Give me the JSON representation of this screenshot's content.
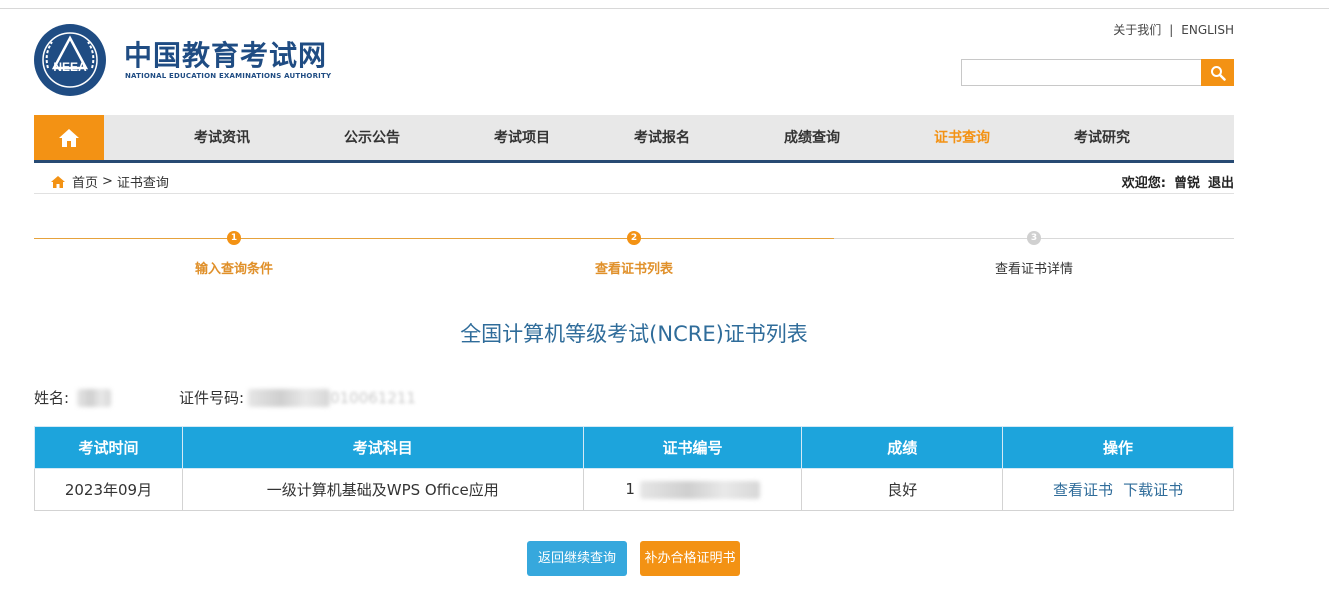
{
  "header": {
    "brand_cn": "中国教育考试网",
    "brand_en": "NATIONAL EDUCATION EXAMINATIONS AUTHORITY",
    "logo_text": "NEEA",
    "about": "关于我们",
    "separator": "|",
    "english": "ENGLISH",
    "search_placeholder": ""
  },
  "nav": {
    "home_icon": "home-icon",
    "items": [
      {
        "label": "考试资讯"
      },
      {
        "label": "公示公告"
      },
      {
        "label": "考试项目"
      },
      {
        "label": "考试报名"
      },
      {
        "label": "成绩查询"
      },
      {
        "label": "证书查询",
        "active": true
      },
      {
        "label": "考试研究"
      }
    ]
  },
  "breadcrumb": {
    "home": "首页",
    "separator": ">",
    "current": "证书查询"
  },
  "user": {
    "welcome": "欢迎您:",
    "name": "曾锐",
    "logout": "退出"
  },
  "steps": [
    {
      "num": "1",
      "label": "输入查询条件",
      "done": true
    },
    {
      "num": "2",
      "label": "查看证书列表",
      "done": true
    },
    {
      "num": "3",
      "label": "查看证书详情",
      "done": false
    }
  ],
  "page_title": "全国计算机等级考试(NCRE)证书列表",
  "person": {
    "name_label": "姓名:",
    "id_label": "证件号码:",
    "id_visible_tail": "010061211"
  },
  "table": {
    "headers": [
      "考试时间",
      "考试科目",
      "证书编号",
      "成绩",
      "操作"
    ],
    "rows": [
      {
        "time": "2023年09月",
        "subject": "一级计算机基础及WPS Office应用",
        "cert_no_prefix": "1",
        "score": "良好",
        "action_view": "查看证书",
        "action_download": "下载证书"
      }
    ]
  },
  "buttons": {
    "back": "返回继续查询",
    "reissue": "补办合格证明书"
  },
  "colors": {
    "brand_blue": "#1f4c83",
    "accent_orange": "#f39214",
    "table_header": "#1da4dc",
    "title_blue": "#2f6c9a"
  }
}
